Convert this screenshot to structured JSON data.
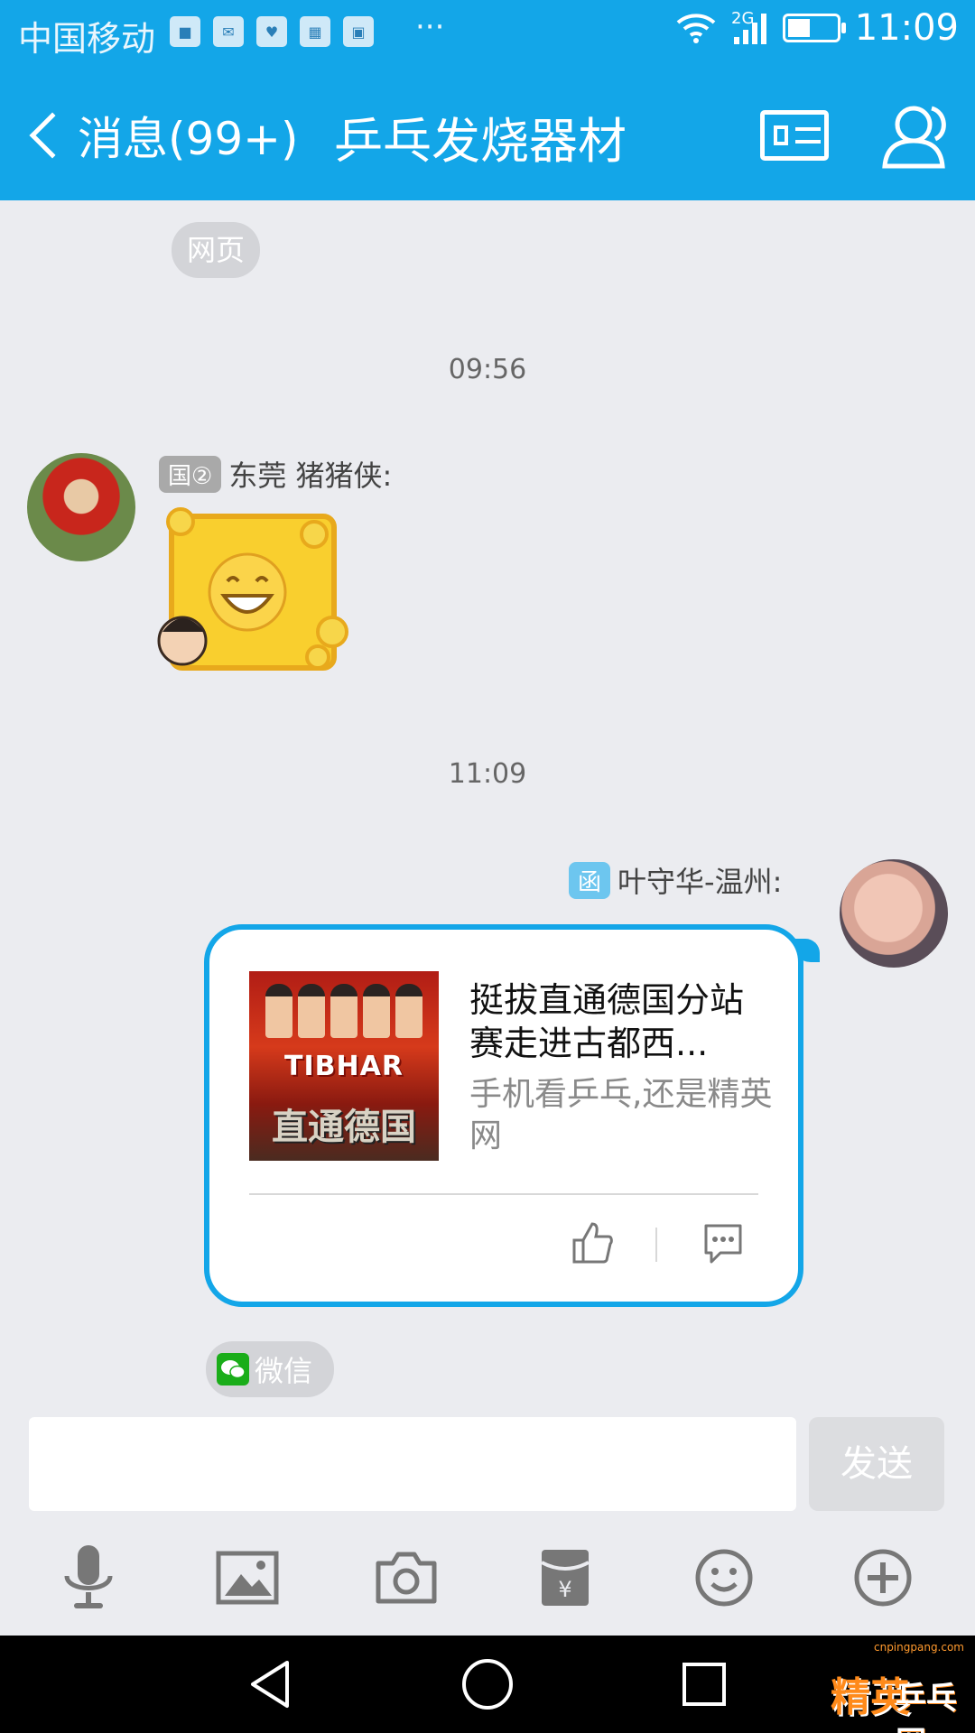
{
  "status_bar": {
    "carrier": "中国移动",
    "network": "2G",
    "time": "11:09",
    "notification_icons": [
      "app-icon",
      "mail-icon",
      "health-icon",
      "gallery-icon",
      "image-icon"
    ],
    "more": "···"
  },
  "header": {
    "back_label": "消息(99+)",
    "title": "乒乓发烧器材",
    "accent_color": "#13a6e8"
  },
  "chat": {
    "chip_web": "网页",
    "messages": [
      {
        "time": "09:56",
        "badge": "国②",
        "sender": "东莞 猪猪侠:",
        "type": "sticker"
      },
      {
        "time": "11:09",
        "badge": "函",
        "sender": "叶守华-温州:",
        "type": "link-card",
        "card": {
          "thumb_brand": "TIBHAR",
          "thumb_banner": "直通德国",
          "title": "挺拔直通德国分站赛走进古都西...",
          "description": "手机看乒乓,还是精英网"
        },
        "source": "微信"
      }
    ]
  },
  "input": {
    "value": "",
    "send_label": "发送"
  },
  "toolbar": [
    "microphone-icon",
    "image-icon",
    "camera-icon",
    "red-packet-icon",
    "emoji-icon",
    "plus-icon"
  ],
  "watermark": {
    "site": "cnpingpang.com",
    "brand_a": "精英",
    "brand_b": "乒乓网"
  }
}
